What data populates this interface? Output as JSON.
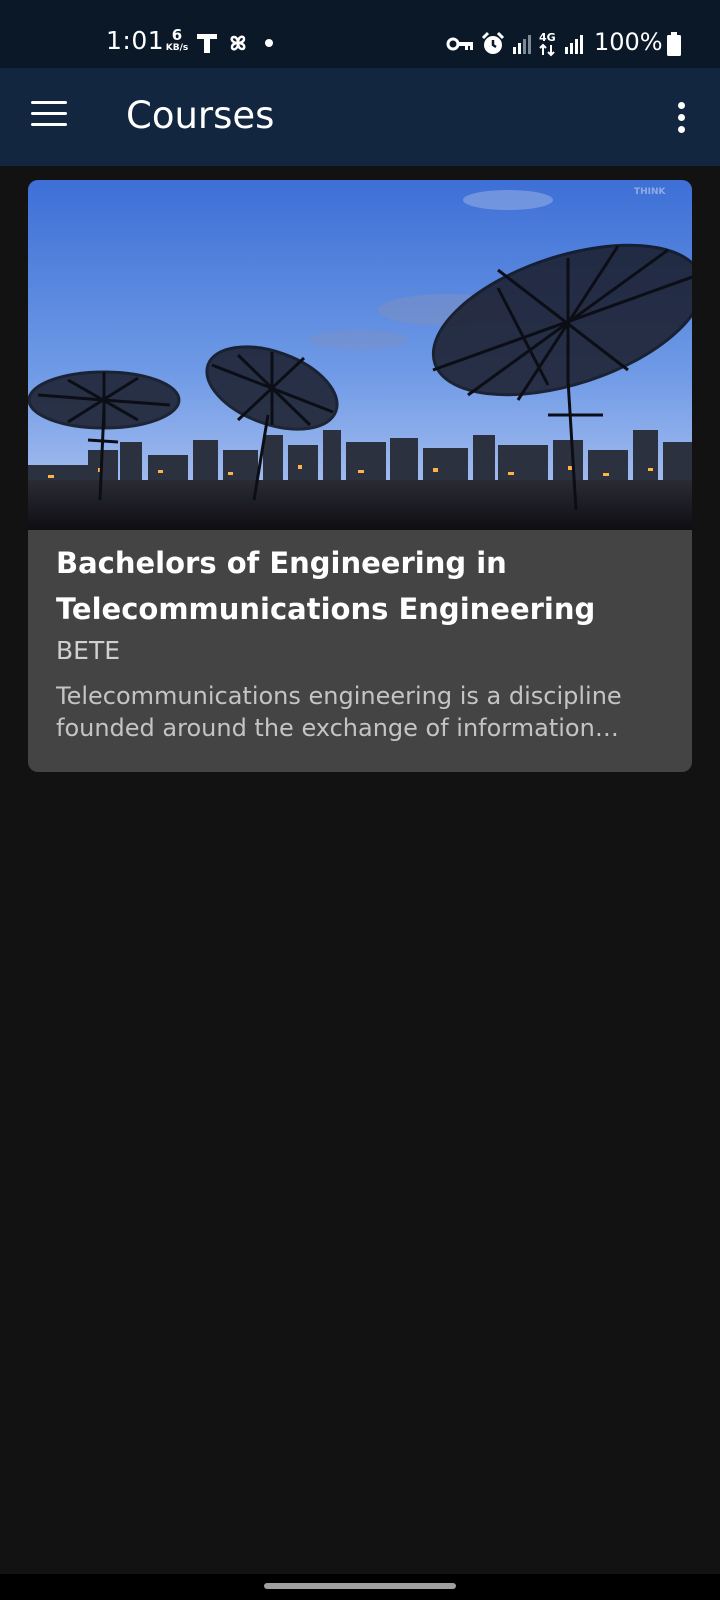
{
  "status_bar": {
    "time": "1:01",
    "net_speed_value": "6",
    "net_speed_unit": "KB/s",
    "left_icons": [
      "t-mobile-icon",
      "pinwheel-icon",
      "notification-dot-icon"
    ],
    "right_icons": [
      "vpn-key-icon",
      "alarm-icon",
      "signal-icon",
      "4g-icon",
      "signal-icon"
    ],
    "network_type": "4G",
    "battery_percent": "100%"
  },
  "app_bar": {
    "title": "Courses",
    "menu_icon": "hamburger-menu-icon",
    "overflow_icon": "more-vert-icon",
    "color": "#12263f"
  },
  "courses": [
    {
      "image_watermark": "THINK",
      "title": "Bachelors of Engineering in Telecommunications Engineering",
      "code": "BETE",
      "description": "Telecommunications engineering is a discipline founded around the exchange of information across channels via wired or wireless means."
    }
  ],
  "colors": {
    "background": "#121212",
    "status_bar": "#0b1828",
    "card": "#444444"
  }
}
